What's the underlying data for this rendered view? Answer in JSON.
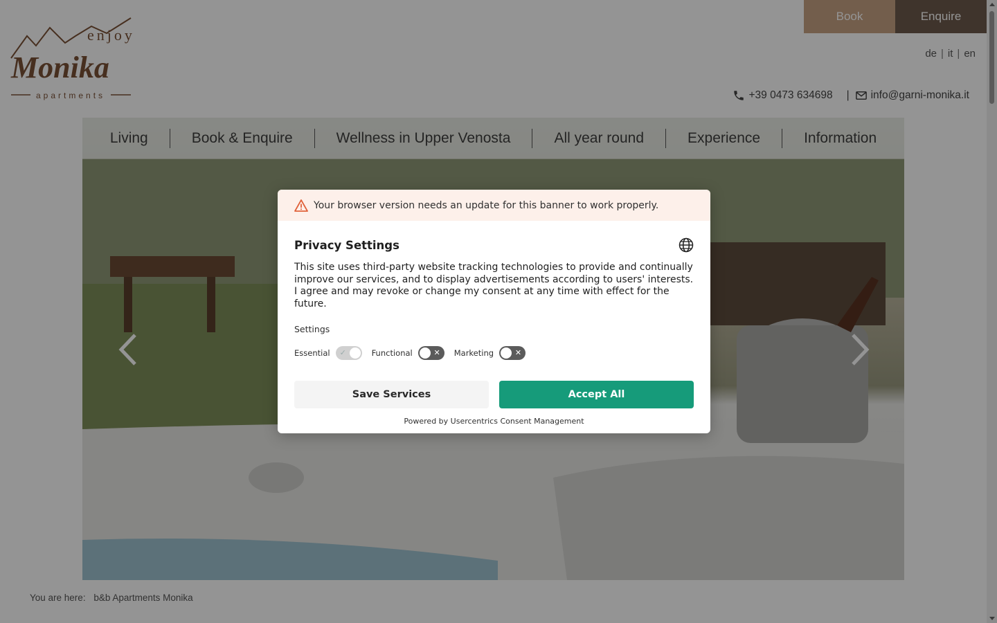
{
  "logo": {
    "line1": "enjoy",
    "line2": "Monika",
    "line3": "apartments",
    "alt": "Enjoy Monika Apartments logo"
  },
  "top_buttons": {
    "book": "Book",
    "enquire": "Enquire"
  },
  "languages": [
    "de",
    "it",
    "en"
  ],
  "contact": {
    "phone": "+39 0473 634698",
    "separator": "|",
    "email": "info@garni-monika.it"
  },
  "nav": [
    "Living",
    "Book & Enquire",
    "Wellness in Upper Venosta",
    "All year round",
    "Experience",
    "Information"
  ],
  "breadcrumb": {
    "prefix": "You are here:",
    "current": "b&b Apartments Monika"
  },
  "consent": {
    "warning": "Your browser version needs an update for this banner to work properly.",
    "title": "Privacy Settings",
    "description": "This site uses third-party website tracking technologies to provide and continually improve our services, and to display advertisements according to users' interests. I agree and may revoke or change my consent at any time with effect for the future.",
    "settings_label": "Settings",
    "toggles": [
      {
        "label": "Essential",
        "state": "on"
      },
      {
        "label": "Functional",
        "state": "off"
      },
      {
        "label": "Marketing",
        "state": "off"
      }
    ],
    "save_button": "Save Services",
    "accept_button": "Accept All",
    "powered_by": "Powered by Usercentrics Consent Management"
  },
  "colors": {
    "book_button": "#c7a383",
    "enquire_button": "#6d5a4c",
    "accept_button": "#169b7a",
    "warning_bg": "#fdf0ea",
    "logo_brown": "#7a5136"
  }
}
